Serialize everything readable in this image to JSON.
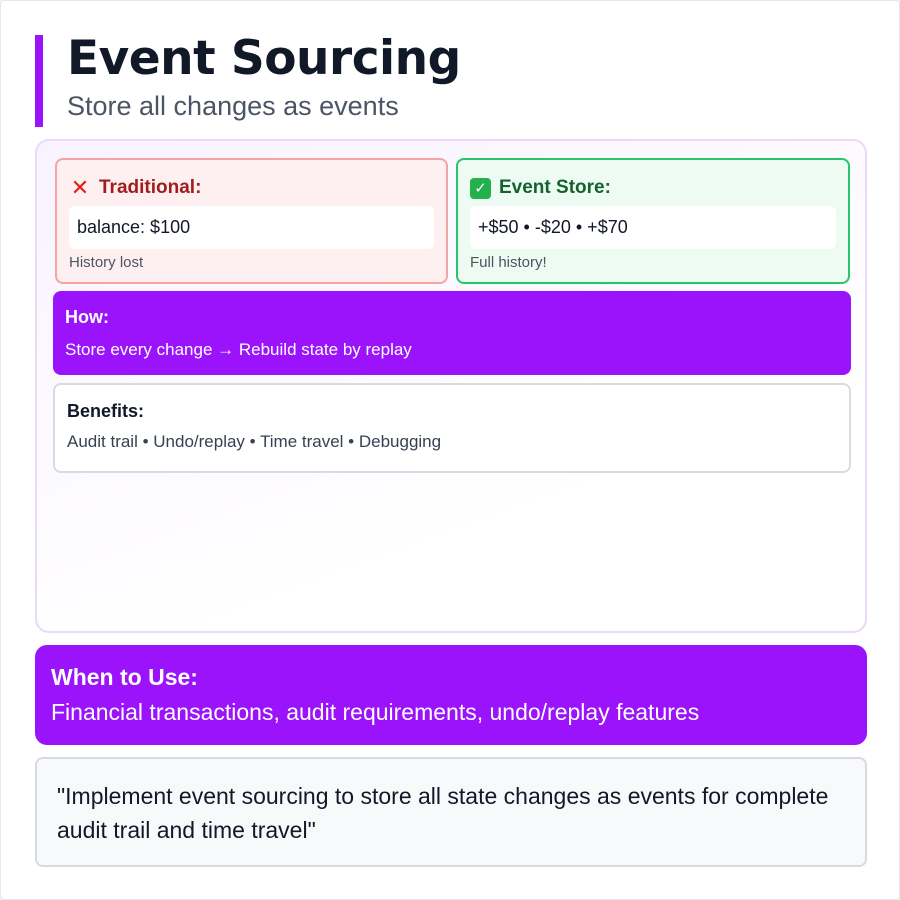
{
  "header": {
    "title": "Event Sourcing",
    "subtitle": "Store all changes as events"
  },
  "traditional": {
    "icon": "cross-mark-icon",
    "title": "Traditional:",
    "value": "balance: $100",
    "note": "History lost"
  },
  "event_store": {
    "icon": "check-mark-icon",
    "title": "Event Store:",
    "value": "+$50 • -$20 • +$70",
    "note": "Full history!"
  },
  "how": {
    "title": "How:",
    "text": "Store every change → Rebuild state by replay"
  },
  "benefits": {
    "title": "Benefits:",
    "text": "Audit trail • Undo/replay • Time travel • Debugging"
  },
  "when_to_use": {
    "title": "When to Use:",
    "text": "Financial transactions, audit requirements, undo/replay features"
  },
  "quote": {
    "text": "\"Implement event sourcing to store all state changes as events for complete audit trail and time travel\""
  },
  "colors": {
    "accent": "#9b13fb",
    "traditional_bg": "#fef0f0",
    "traditional_border": "#f5a3a3",
    "event_store_bg": "#edfbf2",
    "event_store_border": "#28c56c"
  }
}
